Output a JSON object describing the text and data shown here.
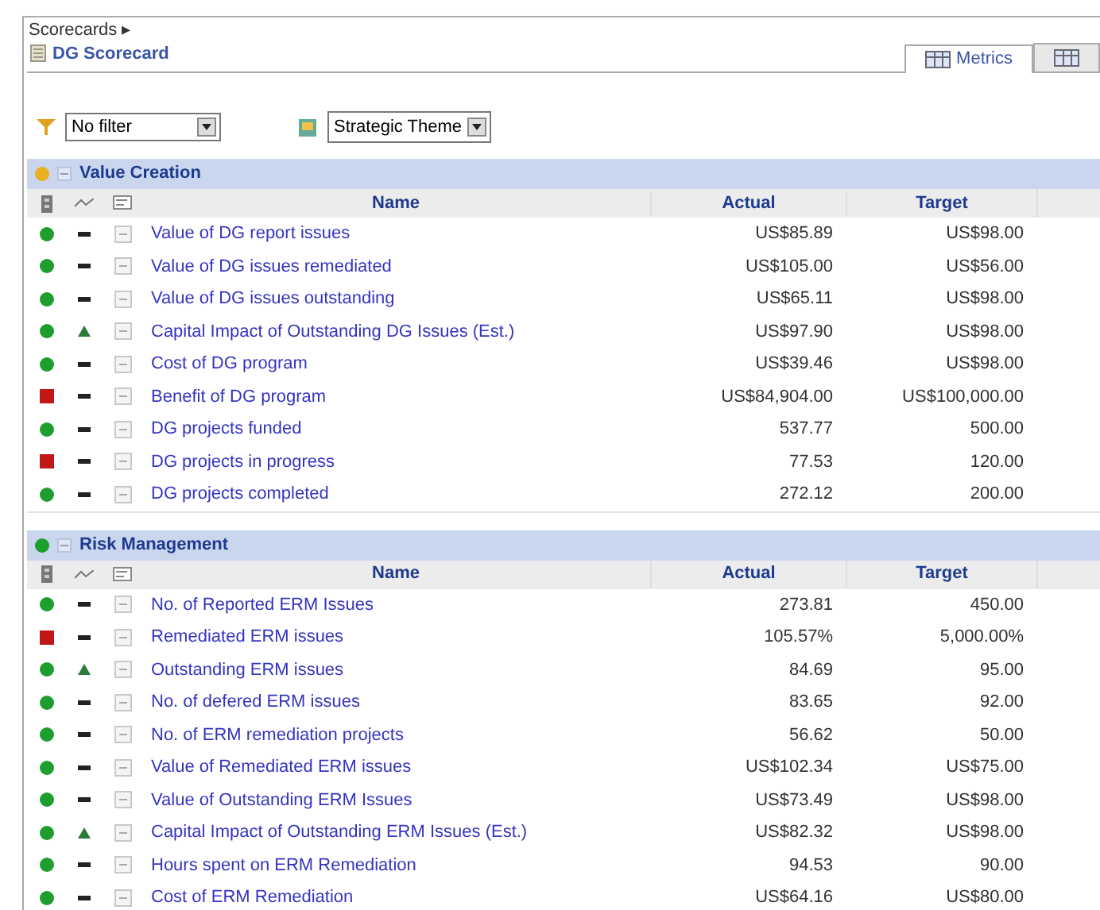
{
  "breadcrumb": "Scorecards ▸",
  "title": "DG Scorecard",
  "tabs": [
    {
      "label": "Metrics",
      "selected": true
    },
    {
      "selected": false
    }
  ],
  "filter": {
    "value": "No filter"
  },
  "grouping": {
    "value": "Strategic Theme"
  },
  "sections": [
    {
      "title": "Value Creation",
      "color": "#e8b020",
      "expanded": true,
      "columns": [
        "Name",
        "Actual",
        "Target"
      ],
      "rows": [
        {
          "color": "#1e9e2e",
          "kind": "flat",
          "name": "Value of DG report issues",
          "actual": "US$85.89",
          "target": "US$98.00"
        },
        {
          "color": "#1e9e2e",
          "kind": "flat",
          "name": "Value of DG issues remediated",
          "actual": "US$105.00",
          "target": "US$56.00"
        },
        {
          "color": "#1e9e2e",
          "kind": "flat",
          "name": "Value of DG issues outstanding",
          "actual": "US$65.11",
          "target": "US$98.00"
        },
        {
          "color": "#1e9e2e",
          "kind": "up",
          "name": "Capital Impact of Outstanding DG Issues (Est.)",
          "actual": "US$97.90",
          "target": "US$98.00"
        },
        {
          "color": "#1e9e2e",
          "kind": "flat",
          "name": "Cost of DG program",
          "actual": "US$39.46",
          "target": "US$98.00"
        },
        {
          "color": "#c01818",
          "kind": "flat",
          "name": "Benefit of DG program",
          "actual": "US$84,904.00",
          "target": "US$100,000.00"
        },
        {
          "color": "#1e9e2e",
          "kind": "flat",
          "name": "DG projects funded",
          "actual": "537.77",
          "target": "500.00"
        },
        {
          "color": "#c01818",
          "kind": "flat",
          "name": "DG projects in progress",
          "actual": "77.53",
          "target": "120.00"
        },
        {
          "color": "#1e9e2e",
          "kind": "flat",
          "name": "DG projects completed",
          "actual": "272.12",
          "target": "200.00"
        }
      ]
    },
    {
      "title": "Risk Management",
      "color": "#1e9e2e",
      "expanded": true,
      "columns": [
        "Name",
        "Actual",
        "Target"
      ],
      "rows": [
        {
          "color": "#1e9e2e",
          "kind": "flat",
          "name": "No. of Reported ERM Issues",
          "actual": "273.81",
          "target": "450.00"
        },
        {
          "color": "#c01818",
          "kind": "flat",
          "name": "Remediated ERM issues",
          "actual": "105.57%",
          "target": "5,000.00%"
        },
        {
          "color": "#1e9e2e",
          "kind": "up",
          "name": "Outstanding ERM issues",
          "actual": "84.69",
          "target": "95.00"
        },
        {
          "color": "#1e9e2e",
          "kind": "flat",
          "name": "No. of defered ERM issues",
          "actual": "83.65",
          "target": "92.00"
        },
        {
          "color": "#1e9e2e",
          "kind": "flat",
          "name": "No. of ERM remediation projects",
          "actual": "56.62",
          "target": "50.00"
        },
        {
          "color": "#1e9e2e",
          "kind": "flat",
          "name": "Value of Remediated ERM issues",
          "actual": "US$102.34",
          "target": "US$75.00"
        },
        {
          "color": "#1e9e2e",
          "kind": "flat",
          "name": "Value of Outstanding ERM Issues",
          "actual": "US$73.49",
          "target": "US$98.00"
        },
        {
          "color": "#1e9e2e",
          "kind": "up",
          "name": "Capital Impact of Outstanding ERM Issues (Est.)",
          "actual": "US$82.32",
          "target": "US$98.00"
        },
        {
          "color": "#1e9e2e",
          "kind": "flat",
          "name": "Hours spent on ERM Remediation",
          "actual": "94.53",
          "target": "90.00"
        },
        {
          "color": "#1e9e2e",
          "kind": "flat",
          "name": "Cost of ERM Remediation",
          "actual": "US$64.16",
          "target": "US$80.00"
        }
      ]
    }
  ]
}
